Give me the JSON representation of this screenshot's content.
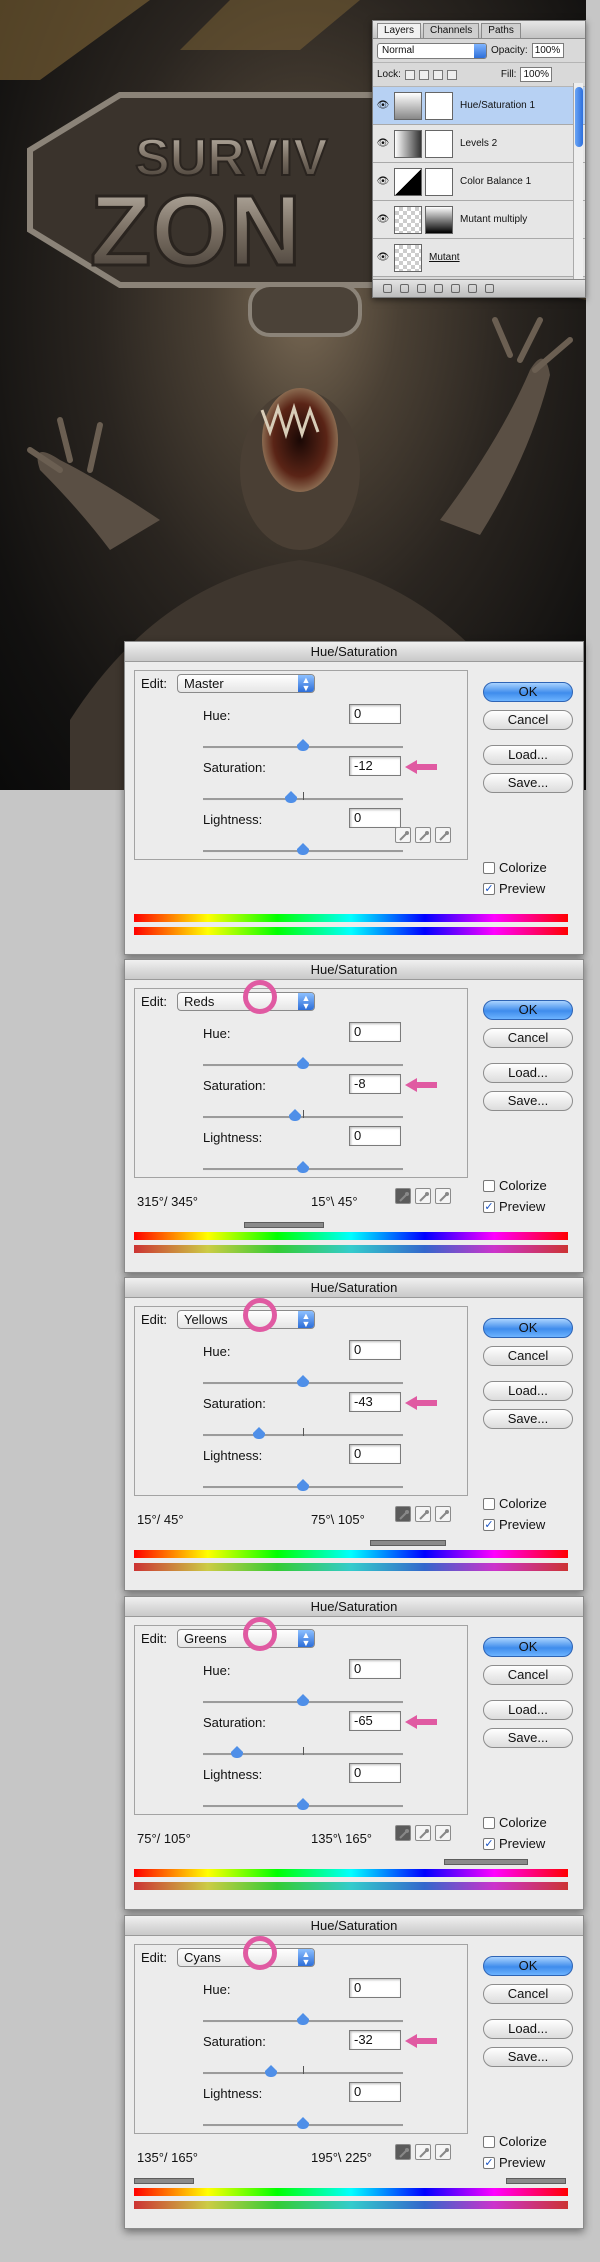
{
  "layers_panel": {
    "tabs": [
      "Layers",
      "Channels",
      "Paths"
    ],
    "blend_mode": "Normal",
    "opacity_label": "Opacity:",
    "opacity_value": "100%",
    "lock_label": "Lock:",
    "fill_label": "Fill:",
    "fill_value": "100%",
    "layers": [
      {
        "name": "Hue/Saturation 1"
      },
      {
        "name": "Levels 2"
      },
      {
        "name": "Color Balance 1"
      },
      {
        "name": "Mutant multiply"
      },
      {
        "name": "Mutant"
      }
    ]
  },
  "dialogs": [
    {
      "title": "Hue/Saturation",
      "edit_label": "Edit:",
      "channel": "Master",
      "hue_label": "Hue:",
      "hue": "0",
      "sat_label": "Saturation:",
      "sat": "-12",
      "light_label": "Lightness:",
      "light": "0",
      "sat_pos": 0.44,
      "range_left": "",
      "range_right": "",
      "ok": "OK",
      "cancel": "Cancel",
      "load": "Load...",
      "save": "Save...",
      "colorize": "Colorize",
      "preview": "Preview"
    },
    {
      "title": "Hue/Saturation",
      "edit_label": "Edit:",
      "channel": "Reds",
      "hue_label": "Hue:",
      "hue": "0",
      "sat_label": "Saturation:",
      "sat": "-8",
      "light_label": "Lightness:",
      "light": "0",
      "sat_pos": 0.46,
      "range_left": "315°/ 345°",
      "range_right": "15°\\ 45°",
      "ok": "OK",
      "cancel": "Cancel",
      "load": "Load...",
      "save": "Save...",
      "colorize": "Colorize",
      "preview": "Preview"
    },
    {
      "title": "Hue/Saturation",
      "edit_label": "Edit:",
      "channel": "Yellows",
      "hue_label": "Hue:",
      "hue": "0",
      "sat_label": "Saturation:",
      "sat": "-43",
      "light_label": "Lightness:",
      "light": "0",
      "sat_pos": 0.28,
      "range_left": "15°/ 45°",
      "range_right": "75°\\ 105°",
      "ok": "OK",
      "cancel": "Cancel",
      "load": "Load...",
      "save": "Save...",
      "colorize": "Colorize",
      "preview": "Preview"
    },
    {
      "title": "Hue/Saturation",
      "edit_label": "Edit:",
      "channel": "Greens",
      "hue_label": "Hue:",
      "hue": "0",
      "sat_label": "Saturation:",
      "sat": "-65",
      "light_label": "Lightness:",
      "light": "0",
      "sat_pos": 0.17,
      "range_left": "75°/ 105°",
      "range_right": "135°\\ 165°",
      "ok": "OK",
      "cancel": "Cancel",
      "load": "Load...",
      "save": "Save...",
      "colorize": "Colorize",
      "preview": "Preview"
    },
    {
      "title": "Hue/Saturation",
      "edit_label": "Edit:",
      "channel": "Cyans",
      "hue_label": "Hue:",
      "hue": "0",
      "sat_label": "Saturation:",
      "sat": "-32",
      "light_label": "Lightness:",
      "light": "0",
      "sat_pos": 0.34,
      "range_left": "135°/ 165°",
      "range_right": "195°\\ 225°",
      "ok": "OK",
      "cancel": "Cancel",
      "load": "Load...",
      "save": "Save...",
      "colorize": "Colorize",
      "preview": "Preview"
    }
  ],
  "artwork": {
    "logo_line1": "SURVIV",
    "logo_line2": "ZON"
  },
  "colors": {
    "highlight": "#e05aa2",
    "accent": "#3f8cec"
  }
}
